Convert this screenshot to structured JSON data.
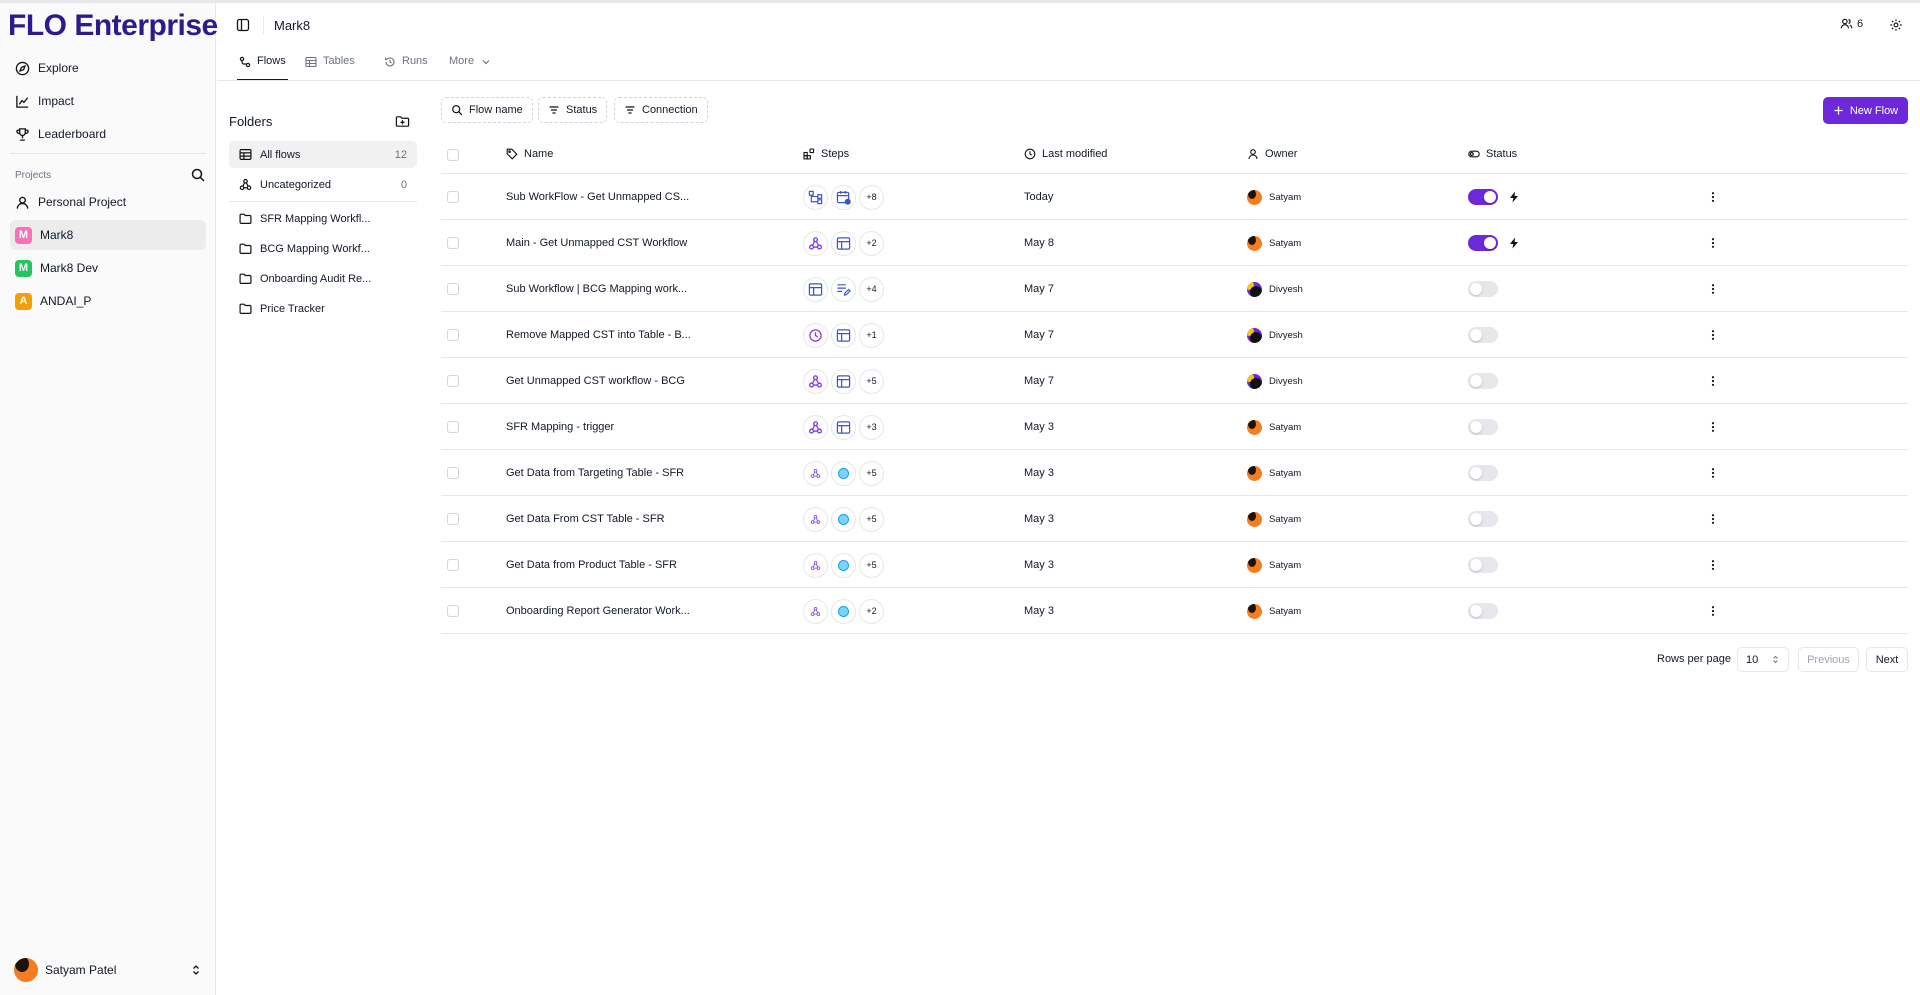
{
  "app": {
    "brand": "FLO Enterprise",
    "project_title": "Mark8",
    "member_count": "6"
  },
  "sidebar": {
    "nav": [
      {
        "label": "Explore",
        "icon": "compass-icon"
      },
      {
        "label": "Impact",
        "icon": "line-chart-icon"
      },
      {
        "label": "Leaderboard",
        "icon": "trophy-icon"
      }
    ],
    "projects_label": "Projects",
    "projects": [
      {
        "label": "Personal Project",
        "icon": "user-icon"
      },
      {
        "label": "Mark8",
        "badge": "M",
        "color": "#ec4899",
        "active": true
      },
      {
        "label": "Mark8 Dev",
        "badge": "M",
        "color": "#22c55e"
      },
      {
        "label": "ANDAI_P",
        "badge": "A",
        "color": "#f59e0b"
      }
    ],
    "user": {
      "name": "Satyam Patel"
    }
  },
  "tabs": [
    {
      "label": "Flows",
      "active": true
    },
    {
      "label": "Tables"
    },
    {
      "label": "Runs"
    },
    {
      "label": "More"
    }
  ],
  "folders": {
    "title": "Folders",
    "items": [
      {
        "label": "All flows",
        "count": "12"
      },
      {
        "label": "Uncategorized",
        "count": "0"
      }
    ],
    "user_folders": [
      "SFR Mapping Workfl...",
      "BCG Mapping Workf...",
      "Onboarding Audit Re...",
      "Price Tracker"
    ]
  },
  "filters": {
    "flow_name": "Flow name",
    "status": "Status",
    "connection": "Connection",
    "new_flow": "New Flow"
  },
  "table": {
    "headers": {
      "name": "Name",
      "steps": "Steps",
      "last_modified": "Last modified",
      "owner": "Owner",
      "status": "Status"
    },
    "rows": [
      {
        "name": "Sub WorkFlow - Get Unmapped CS...",
        "steps": [
          "tree",
          "calendar"
        ],
        "more": "+8",
        "modified": "Today",
        "owner": "Satyam",
        "enabled": true
      },
      {
        "name": "Main - Get Unmapped CST Workflow",
        "steps": [
          "webhook",
          "table"
        ],
        "more": "+2",
        "modified": "May 8",
        "owner": "Satyam",
        "enabled": true
      },
      {
        "name": "Sub Workflow | BCG Mapping work...",
        "steps": [
          "table",
          "edit-list"
        ],
        "more": "+4",
        "modified": "May 7",
        "owner": "Divyesh",
        "enabled": false
      },
      {
        "name": "Remove Mapped CST into Table - B...",
        "steps": [
          "clock",
          "table"
        ],
        "more": "+1",
        "modified": "May 7",
        "owner": "Divyesh",
        "enabled": false
      },
      {
        "name": "Get Unmapped CST workflow - BCG",
        "steps": [
          "webhook",
          "table"
        ],
        "more": "+5",
        "modified": "May 7",
        "owner": "Divyesh",
        "enabled": false
      },
      {
        "name": "SFR Mapping - trigger",
        "steps": [
          "webhook",
          "table"
        ],
        "more": "+3",
        "modified": "May 3",
        "owner": "Satyam",
        "enabled": false
      },
      {
        "name": "Get Data from Targeting Table - SFR",
        "steps": [
          "webhook-small",
          "dot"
        ],
        "more": "+5",
        "modified": "May 3",
        "owner": "Satyam",
        "enabled": false
      },
      {
        "name": "Get Data From CST Table - SFR",
        "steps": [
          "webhook-small",
          "dot"
        ],
        "more": "+5",
        "modified": "May 3",
        "owner": "Satyam",
        "enabled": false
      },
      {
        "name": "Get Data from Product Table - SFR",
        "steps": [
          "webhook-small",
          "dot"
        ],
        "more": "+5",
        "modified": "May 3",
        "owner": "Satyam",
        "enabled": false
      },
      {
        "name": "Onboarding Report Generator Work...",
        "steps": [
          "webhook-small",
          "dot"
        ],
        "more": "+2",
        "modified": "May 3",
        "owner": "Satyam",
        "enabled": false
      }
    ]
  },
  "pagination": {
    "rows_label": "Rows per page",
    "rows_value": "10",
    "previous": "Previous",
    "next": "Next"
  },
  "colors": {
    "brand": "#2e1a8c",
    "accent": "#6d28d9"
  }
}
